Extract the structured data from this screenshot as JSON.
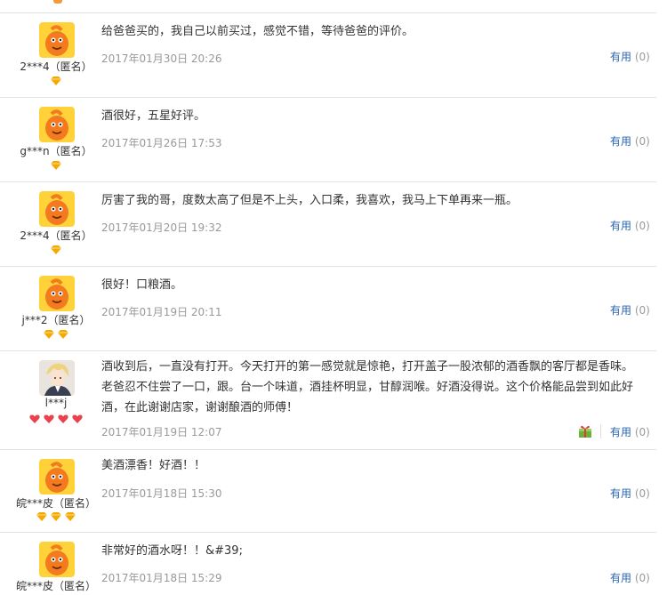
{
  "reviews": [
    {
      "username": "2***4（匿名）",
      "content": "给爸爸买的，我自己以前买过，感觉不错，等待爸爸的评价。",
      "date": "2017年01月30日 20:26",
      "useful_label": "有用",
      "useful_count": "(0)",
      "level_icons": 1
    },
    {
      "username": "g***n（匿名）",
      "content": "酒很好，五星好评。",
      "date": "2017年01月26日 17:53",
      "useful_label": "有用",
      "useful_count": "(0)",
      "level_icons": 1
    },
    {
      "username": "2***4（匿名）",
      "content": "厉害了我的哥，度数太高了但是不上头，入口柔，我喜欢，我马上下单再来一瓶。",
      "date": "2017年01月20日 19:32",
      "useful_label": "有用",
      "useful_count": "(0)",
      "level_icons": 1
    },
    {
      "username": "j***2（匿名）",
      "content": "很好！口粮酒。",
      "date": "2017年01月19日 20:11",
      "useful_label": "有用",
      "useful_count": "(0)",
      "level_icons": 2
    },
    {
      "username": "l***j",
      "content": "酒收到后，一直没有打开。今天打开的第一感觉就是惊艳，打开盖子一股浓郁的酒香飘的客厅都是香味。老爸忍不住尝了一口，跟。台一个味道，酒挂杯明显，甘醇润喉。好酒没得说。这个价格能品尝到如此好酒，在此谢谢店家，谢谢酿酒的师傅！",
      "date": "2017年01月19日 12:07",
      "useful_label": "有用",
      "useful_count": "(0)",
      "level_icons": 4
    },
    {
      "username": "皖***皮（匿名）",
      "content": "美酒漂香！好酒！！",
      "date": "2017年01月18日 15:30",
      "useful_label": "有用",
      "useful_count": "(0)",
      "level_icons": 3
    },
    {
      "username": "皖***皮（匿名）",
      "content": "非常好的酒水呀！！&#39;",
      "date": "2017年01月18日 15:29",
      "useful_label": "有用",
      "useful_count": "(0)",
      "level_icons": 0
    }
  ],
  "colors": {
    "link": "#2a66b0",
    "meta": "#999999",
    "divider": "#e3e3e3",
    "diamond": "#f5a800",
    "heart": "#e8434d"
  },
  "icons": {
    "avatar_default": "orange-mascot-avatar",
    "avatar_photo": "anime-character-avatar",
    "level": "gold-diamond-icon",
    "vip_level": "red-heart-icon",
    "gift": "gift-icon"
  }
}
